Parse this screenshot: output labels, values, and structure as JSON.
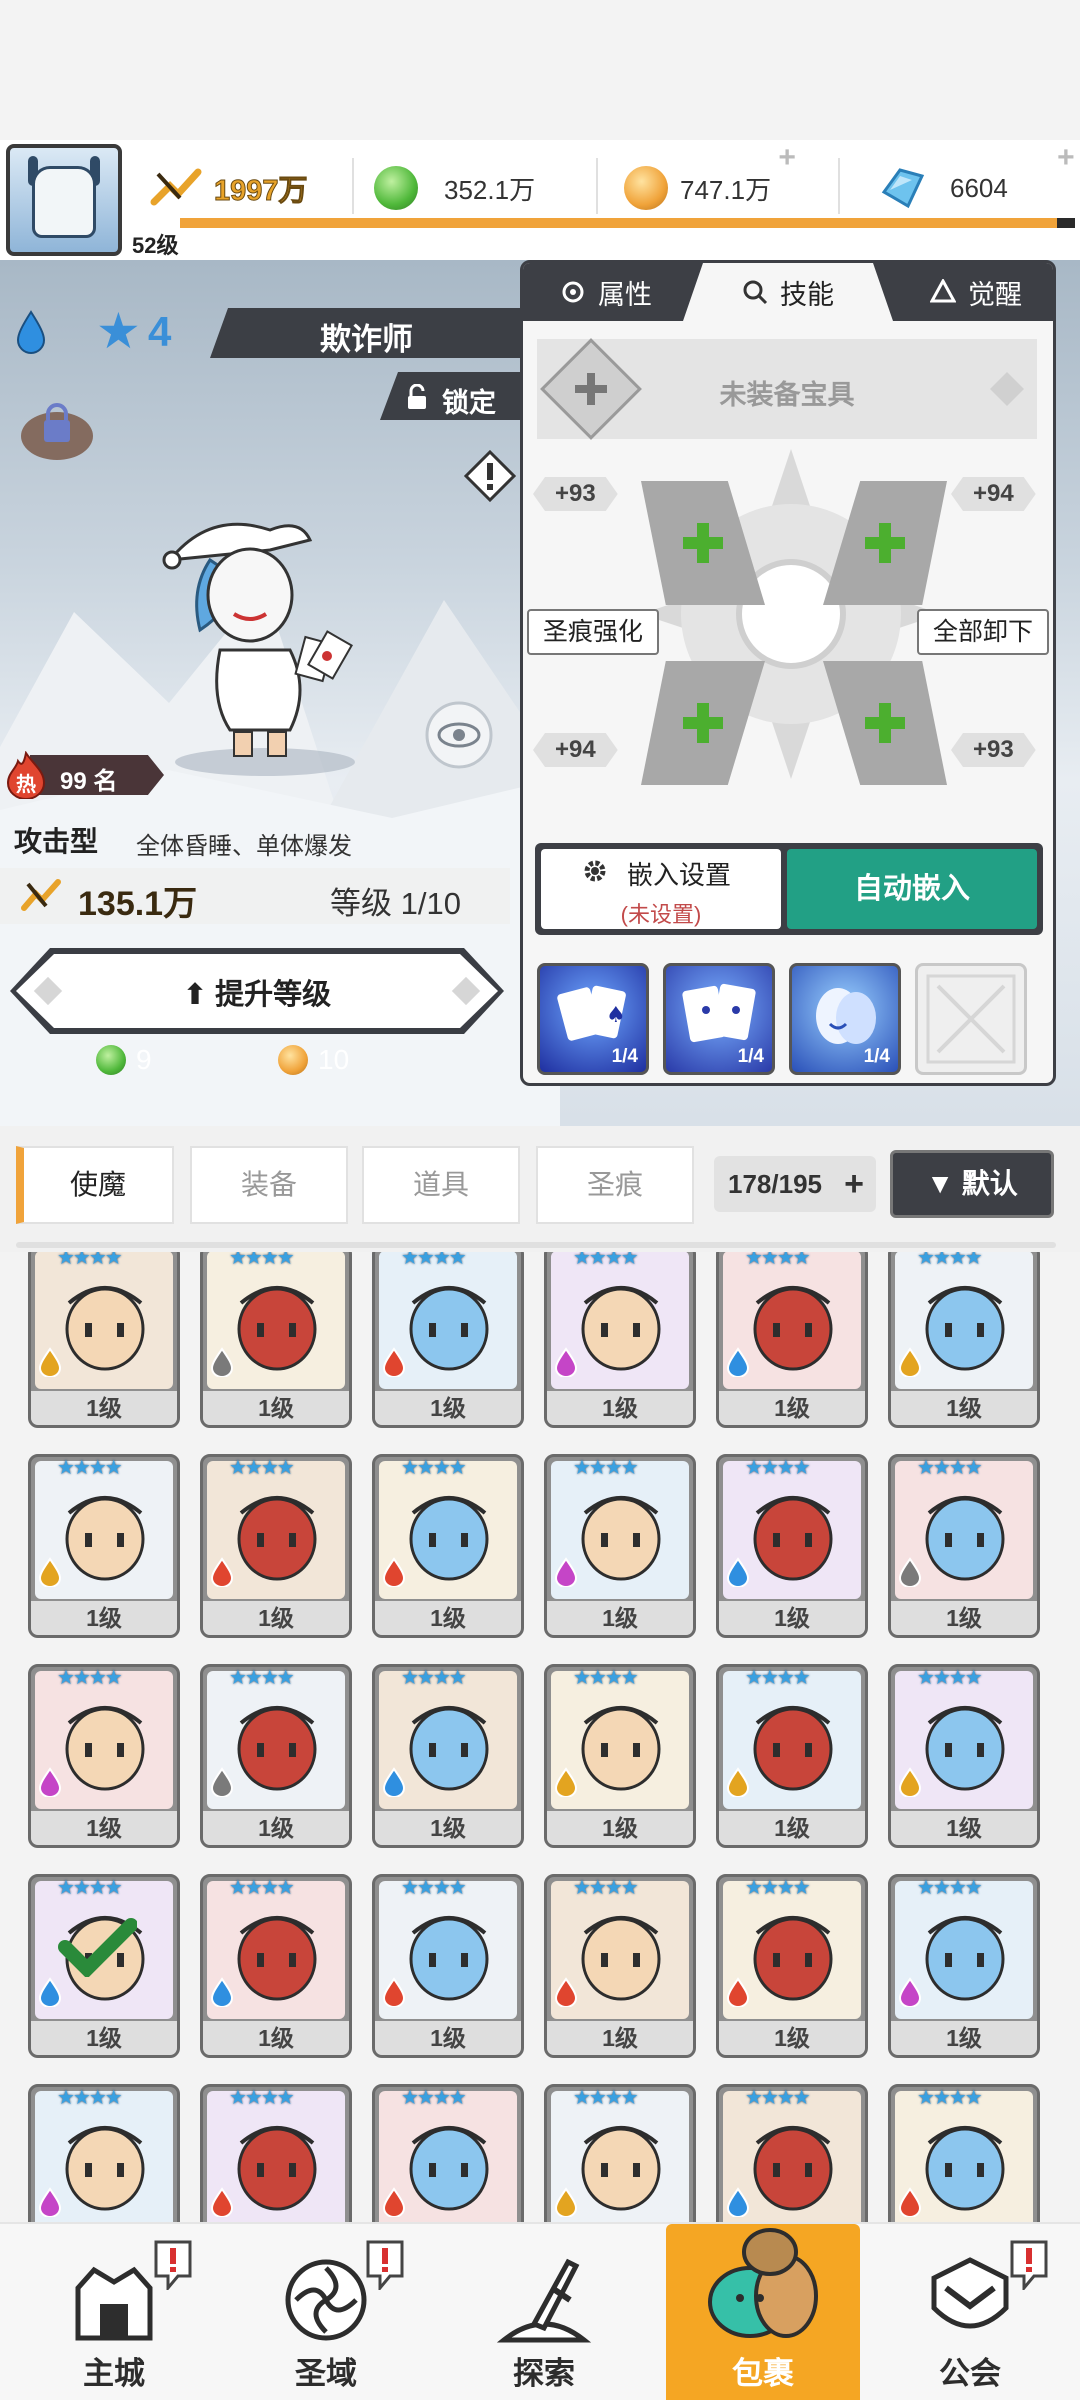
{
  "resources": {
    "level_label": "52级",
    "xp_fraction": 0.98,
    "power": "1997万",
    "green_gem": "352.1万",
    "gold_coin": "747.1万",
    "diamond": "6604"
  },
  "hero": {
    "star_count": "4",
    "name": "欺诈师",
    "lock_label": "锁定",
    "rank_hot": "热",
    "rank": "99 名",
    "type": "攻击型",
    "skills_desc": "全体昏睡、单体爆发",
    "combat_power": "135.1万",
    "grade": "等级 1/10",
    "upgrade_label": "提升等级",
    "cost_green": "9",
    "cost_gold": "10"
  },
  "panel": {
    "tabs": [
      {
        "label": "属性",
        "active": false
      },
      {
        "label": "技能",
        "active": true
      },
      {
        "label": "觉醒",
        "active": false
      }
    ],
    "treasure_label": "未装备宝具",
    "rune_tags": [
      "+93",
      "+94",
      "+94",
      "+93"
    ],
    "enhance_label": "圣痕强化",
    "unequip_label": "全部卸下",
    "embed_settings": "嵌入设置",
    "embed_status": "(未设置)",
    "auto_embed": "自动嵌入",
    "skill_cards": [
      {
        "count": "1/4"
      },
      {
        "count": "1/4"
      },
      {
        "count": "1/4"
      }
    ]
  },
  "filter": {
    "tabs": [
      "使魔",
      "装备",
      "道具",
      "圣痕"
    ],
    "active_tab": "使魔",
    "count": "178/195",
    "sort": "默认"
  },
  "grid": {
    "cards": [
      {
        "level": "1级",
        "element": "wind"
      },
      {
        "level": "1级",
        "element": "light"
      },
      {
        "level": "1级",
        "element": "fire"
      },
      {
        "level": "1级",
        "element": "dark"
      },
      {
        "level": "1级",
        "element": "water"
      },
      {
        "level": "1级",
        "element": "wind"
      },
      {
        "level": "1级",
        "element": "wind"
      },
      {
        "level": "1级",
        "element": "fire"
      },
      {
        "level": "1级",
        "element": "fire"
      },
      {
        "level": "1级",
        "element": "dark"
      },
      {
        "level": "1级",
        "element": "water"
      },
      {
        "level": "1级",
        "element": "light"
      },
      {
        "level": "1级",
        "element": "dark"
      },
      {
        "level": "1级",
        "element": "light"
      },
      {
        "level": "1级",
        "element": "water"
      },
      {
        "level": "1级",
        "element": "wind"
      },
      {
        "level": "1级",
        "element": "wind"
      },
      {
        "level": "1级",
        "element": "wind"
      },
      {
        "level": "1级",
        "element": "water",
        "equipped": true
      },
      {
        "level": "1级",
        "element": "water"
      },
      {
        "level": "1级",
        "element": "fire"
      },
      {
        "level": "1级",
        "element": "fire"
      },
      {
        "level": "1级",
        "element": "fire"
      },
      {
        "level": "1级",
        "element": "dark"
      },
      {
        "level": "",
        "element": "dark"
      },
      {
        "level": "",
        "element": "fire"
      },
      {
        "level": "",
        "element": "fire"
      },
      {
        "level": "",
        "element": "wind"
      },
      {
        "level": "",
        "element": "water"
      },
      {
        "level": "",
        "element": "fire"
      }
    ]
  },
  "nav": [
    {
      "label": "主城",
      "icon": "castle-icon",
      "alert": true
    },
    {
      "label": "圣域",
      "icon": "vortex-icon",
      "alert": true
    },
    {
      "label": "探索",
      "icon": "sword-stone-icon",
      "alert": false
    },
    {
      "label": "包裹",
      "icon": "bag-icon",
      "alert": false,
      "active": true
    },
    {
      "label": "公会",
      "icon": "guild-icon",
      "alert": true
    }
  ],
  "colors": {
    "accent": "#f5a623",
    "teal": "#22a085",
    "dark": "#3d3f45",
    "water": "#2f8fe0",
    "fire": "#e0452f",
    "wind": "#e3a420",
    "dark_element": "#c545c7",
    "light": "#7a7a7a"
  }
}
